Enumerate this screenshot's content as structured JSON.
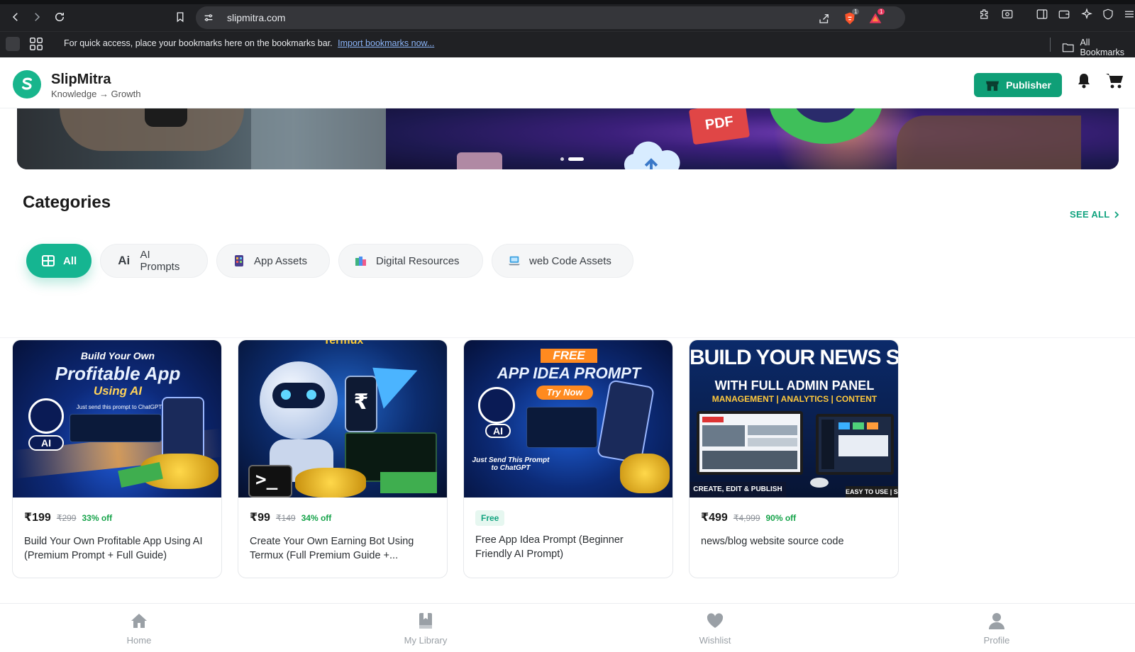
{
  "browser": {
    "url": "slipmitra.com",
    "bookmarks_prompt": "For quick access, place your bookmarks here on the bookmarks bar.",
    "import_link": "Import bookmarks now...",
    "all_bookmarks": "All Bookmarks",
    "shield_badge": "1",
    "alert_badge": "1"
  },
  "header": {
    "brand": "SlipMitra",
    "tagline": "Knowledge → Growth",
    "publisher_label": "Publisher"
  },
  "categories": {
    "title": "Categories",
    "see_all": "SEE ALL",
    "items": [
      {
        "label": "All",
        "icon": "grid-icon",
        "active": true
      },
      {
        "label": "AI Prompts",
        "icon": "ai-text-icon",
        "active": false
      },
      {
        "label": "App Assets",
        "icon": "phone-app-icon",
        "active": false
      },
      {
        "label": "Digital Resources",
        "icon": "books-icon",
        "active": false
      },
      {
        "label": "web Code Assets",
        "icon": "laptop-icon",
        "active": false
      }
    ]
  },
  "products": [
    {
      "price": "₹199",
      "mrp": "₹299",
      "discount": "33% off",
      "free": false,
      "title": "Build Your Own Profitable App Using AI (Premium Prompt + Full Guide)",
      "art": {
        "line1": "Build Your Own",
        "line2": "Profitable App",
        "line3": "Using AI",
        "line4": "Just send this prompt to ChatGPT",
        "badge": "AI"
      }
    },
    {
      "price": "₹99",
      "mrp": "₹149",
      "discount": "34% off",
      "free": false,
      "title": "Create Your Own Earning Bot Using Termux (Full Premium Guide +...",
      "art": {
        "line1": "Termux",
        "badge": "₹"
      }
    },
    {
      "price": "",
      "mrp": "",
      "discount": "",
      "free": true,
      "free_label": "Free",
      "title": "Free App Idea Prompt (Beginner Friendly AI Prompt)",
      "art": {
        "line1": "FREE",
        "line2": "APP IDEA PROMPT",
        "line3": "Try Now",
        "line4": "Just Send This Prompt to ChatGPT",
        "badge": "AI"
      }
    },
    {
      "price": "₹499",
      "mrp": "₹4,999",
      "discount": "90% off",
      "free": false,
      "title": "news/blog website source code",
      "art": {
        "line1": "BUILD YOUR NEWS SIT",
        "line2": "WITH FULL ADMIN PANEL",
        "line3": "MANAGEMENT | ANALYTICS | CONTENT",
        "line4": "CREATE, EDIT & PUBLISH INSTANTLY!",
        "line5": "EASY TO USE | SEC"
      }
    }
  ],
  "bottom_nav": [
    {
      "label": "Home",
      "icon": "home-icon"
    },
    {
      "label": "My Library",
      "icon": "library-icon"
    },
    {
      "label": "Wishlist",
      "icon": "heart-icon"
    },
    {
      "label": "Profile",
      "icon": "user-icon"
    }
  ],
  "colors": {
    "accent": "#15b591",
    "publisher": "#0f9f77",
    "discount": "#16a34a",
    "chrome_bg": "#202124"
  }
}
